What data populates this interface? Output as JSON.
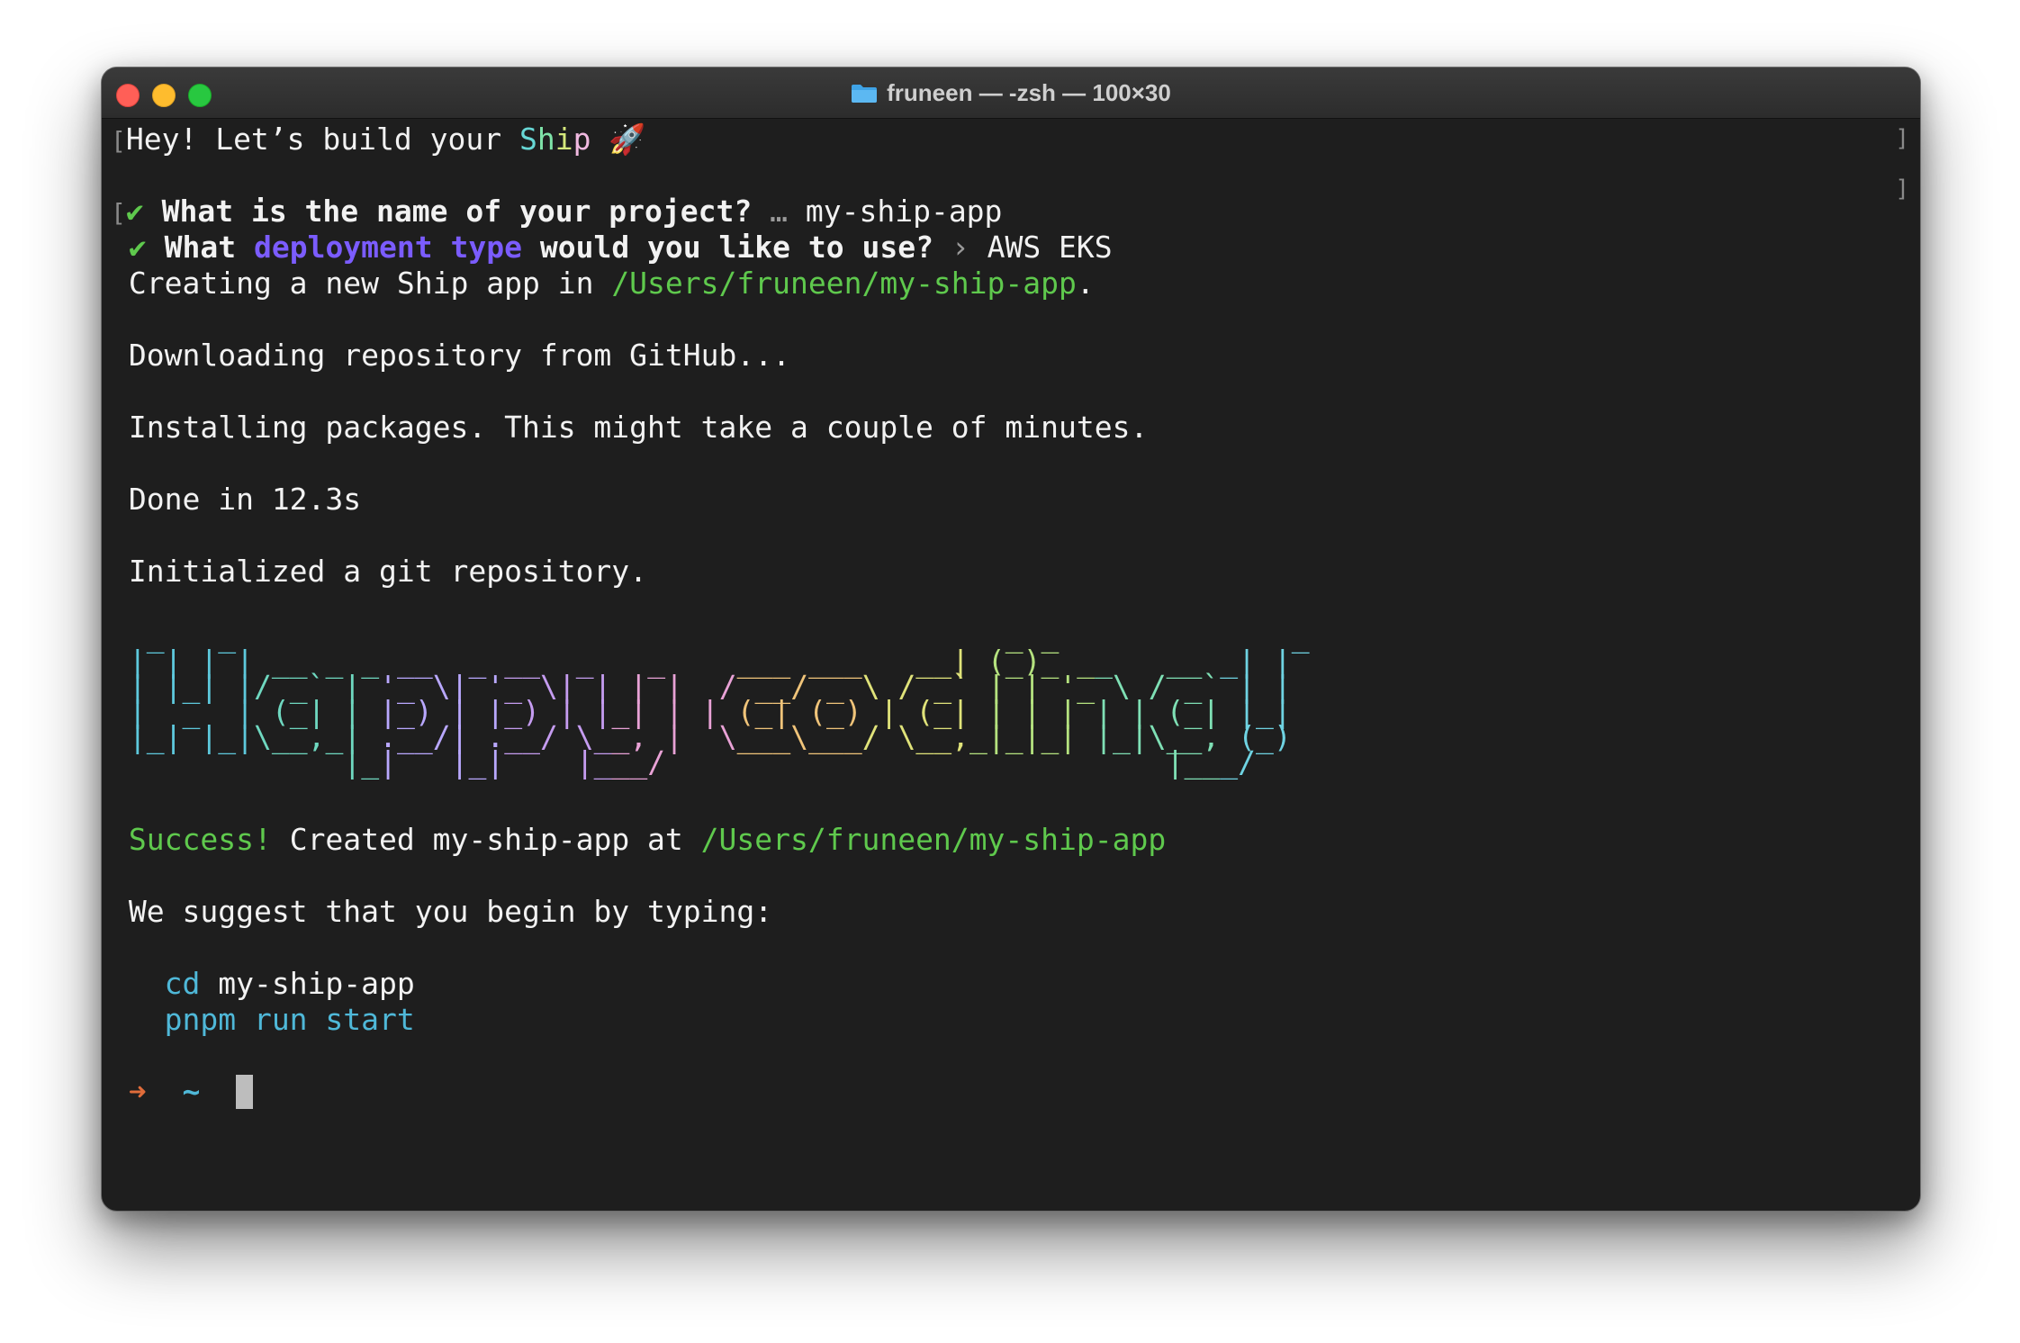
{
  "window": {
    "title": "fruneen — -zsh — 100×30",
    "title_icon": "folder-icon"
  },
  "colors": {
    "background": "#1e1e1e",
    "text": "#f2f2f2",
    "success_green": "#5fc94d",
    "purple": "#7b5cff",
    "cyan": "#4fb8d8",
    "prompt_arrow": "#e06c3a"
  },
  "greeting": {
    "prefix": "Hey! Let’s build your ",
    "ship": [
      "S",
      "h",
      "i",
      "p"
    ],
    "emoji": "🚀"
  },
  "q1": {
    "check": "✔",
    "question": "What is the name of your project?",
    "separator": "…",
    "answer": "my-ship-app"
  },
  "q2": {
    "check": "✔",
    "part1": "What ",
    "highlight": "deployment type",
    "part2": " would you like to use?",
    "separator": "›",
    "answer": "AWS EKS"
  },
  "creating": {
    "prefix": "Creating a new Ship app in ",
    "path": "/Users/fruneen/my-ship-app",
    "suffix": "."
  },
  "downloading": "Downloading repository from GitHub...",
  "installing": "Installing packages. This might take a couple of minutes.",
  "done": "Done in 12.3s",
  "git": "Initialized a git repository.",
  "ascii_art": {
    "text": "Happy coding!",
    "lines": [
      [
        " _   _                                           _ _             _ "
      ],
      [
        "| | | | __ _ _ __  _ __  _   _    ___ ___   __| (_)_ __   __ _| |"
      ],
      [
        "| |_| |/ _` | '_ \\| '_ \\| | | |  / __/ _ \\ / _` | | '_ \\ / _` | |"
      ],
      [
        "|  _  | (_| | |_) | |_) | |_| | | (_| (_) | (_| | | | | | (_| |_|"
      ],
      [
        "|_| |_|\\__,_| .__/| .__/ \\__, |  \\___\\___/ \\__,_|_|_| |_|\\__, (_)"
      ],
      [
        "            |_|   |_|    |___/                            |___/    "
      ]
    ]
  },
  "success": {
    "label": "Success!",
    "text": " Created my-ship-app at ",
    "path": "/Users/fruneen/my-ship-app"
  },
  "suggest": "We suggest that you begin by typing:",
  "commands": [
    {
      "cmd": "cd",
      "args": " my-ship-app"
    },
    {
      "cmd": "pnpm run start",
      "args": ""
    }
  ],
  "prompt": {
    "arrow": "➜",
    "dir": "~"
  }
}
